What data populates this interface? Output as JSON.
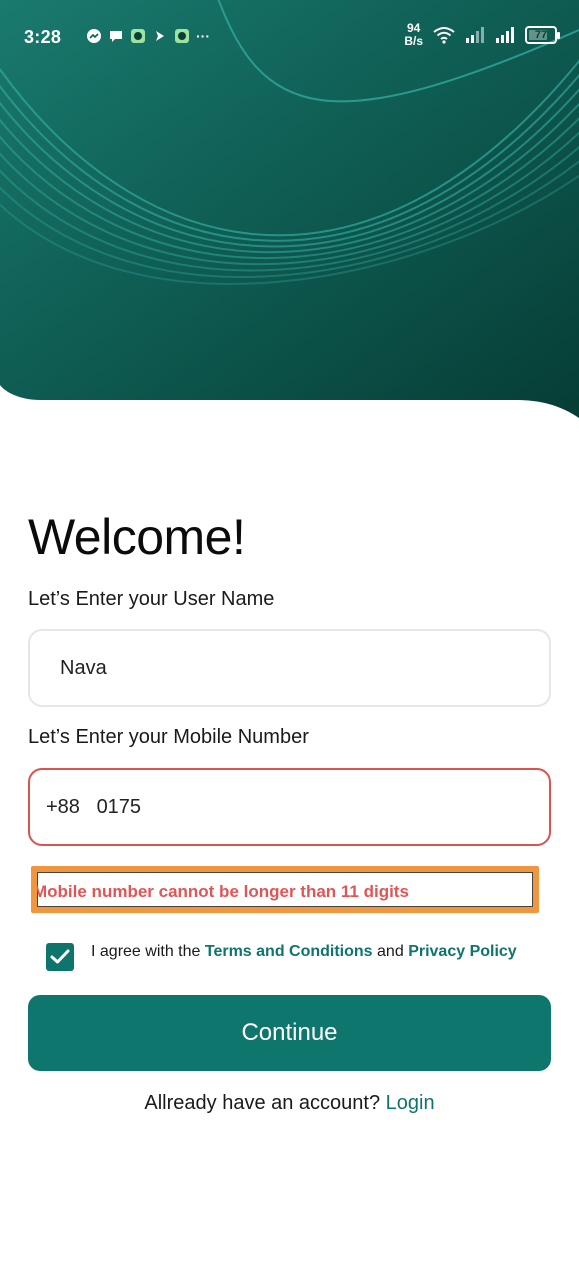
{
  "status_bar": {
    "time": "3:28",
    "net_speed_value": "94",
    "net_speed_unit": "B/s",
    "battery": "77",
    "battery_level": 0.77,
    "more_glyph": "···",
    "notification_icons": [
      "messenger-icon",
      "chat-bubble-icon",
      "app-icon",
      "arrow-icon",
      "app-icon"
    ],
    "right_icons": [
      "wifi-icon",
      "signal-icon",
      "signal-icon",
      "battery-icon"
    ]
  },
  "hero": {
    "bg_color": "#0b4a41",
    "curve_color": "#2fa59a"
  },
  "form": {
    "title": "Welcome!",
    "username_label": "Let’s Enter your User Name",
    "username_value": "Nava",
    "mobile_label": "Let’s Enter your Mobile Number",
    "mobile_prefix": "+88",
    "mobile_value": "0175",
    "error_text": "Mobile number cannot be longer than 11 digits",
    "agree_checked": true,
    "agree_prefix": "I agree with the",
    "terms_link": "Terms and Conditions",
    "and_word": "and",
    "privacy_link": "Privacy Policy",
    "continue_label": "Continue",
    "account_prompt": "Allready have an account?",
    "login_link": "Login"
  },
  "colors": {
    "accent": "#0f766e",
    "error": "#e05656",
    "error_border": "#d9534f",
    "highlight": "#f0963f"
  }
}
